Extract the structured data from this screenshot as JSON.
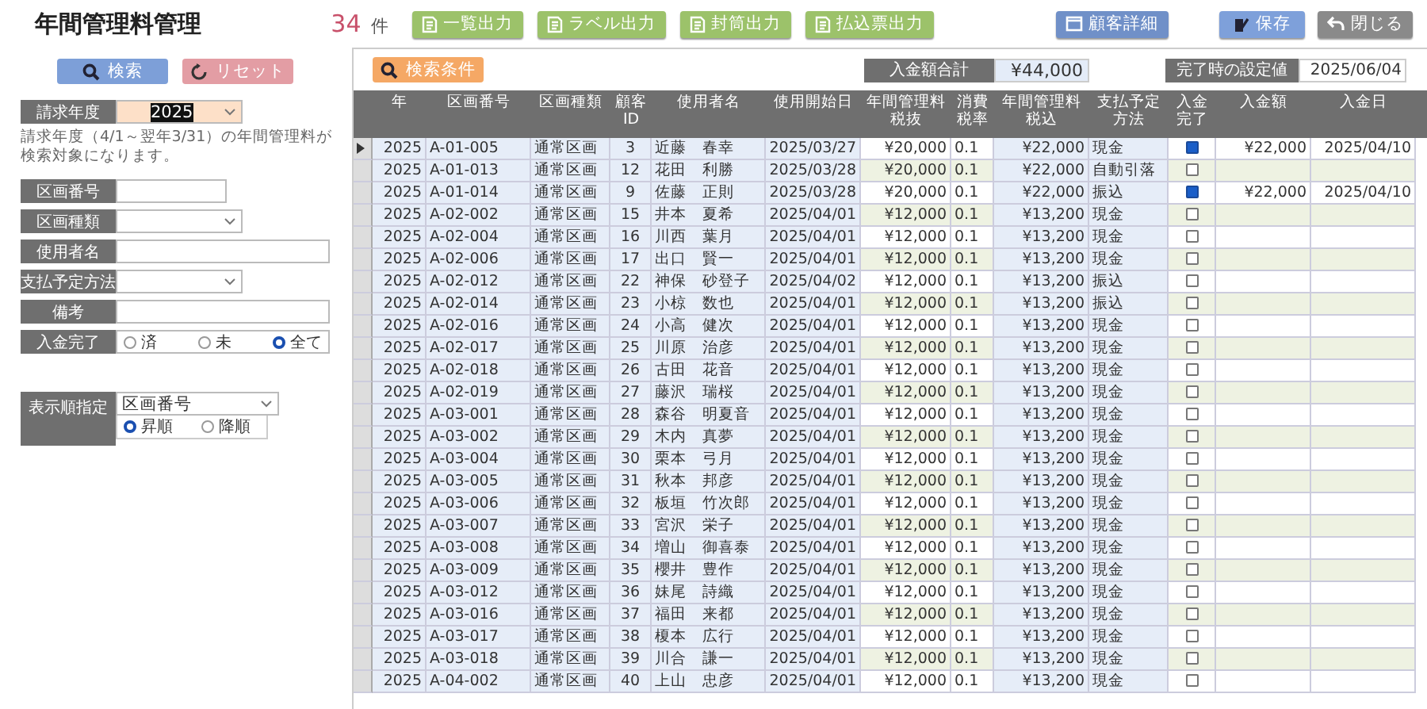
{
  "title": "年間管理料管理",
  "count": {
    "value": "34",
    "unit": "件"
  },
  "toolbar_buttons": [
    {
      "label": "一覧出力",
      "kind": "output"
    },
    {
      "label": "ラベル出力",
      "kind": "output"
    },
    {
      "label": "封筒出力",
      "kind": "output"
    },
    {
      "label": "払込票出力",
      "kind": "output"
    },
    {
      "label": "顧客詳細",
      "kind": "detail"
    },
    {
      "label": "保存",
      "kind": "save"
    },
    {
      "label": "閉じる",
      "kind": "close"
    }
  ],
  "search_panel": {
    "search_button": "検索",
    "reset_button": "リセット",
    "fields": [
      {
        "kind": "combo",
        "label": "請求年度",
        "value": "2025",
        "highlighted": true
      },
      {
        "kind": "note",
        "text": "請求年度（4/1～翌年3/31）の年間管理料が検索対象になります。"
      },
      {
        "kind": "text",
        "label": "区画番号"
      },
      {
        "kind": "combo",
        "label": "区画種類"
      },
      {
        "kind": "text_wide",
        "label": "使用者名"
      },
      {
        "kind": "combo",
        "label": "支払予定方法"
      },
      {
        "kind": "text_wide",
        "label": "備考"
      },
      {
        "kind": "radio",
        "label": "入金完了",
        "options": [
          {
            "label": "済",
            "selected": false
          },
          {
            "label": "未",
            "selected": false
          },
          {
            "label": "全て",
            "selected": true
          }
        ]
      }
    ],
    "sort": {
      "label": "表示順指定",
      "value": "区画番号",
      "options": [
        {
          "label": "昇順",
          "selected": true
        },
        {
          "label": "降順",
          "selected": false
        }
      ]
    }
  },
  "results": {
    "filter_button": "検索条件",
    "total": {
      "label": "入金額合計",
      "value": "¥44,000"
    },
    "completion": {
      "label": "完了時の設定値",
      "value": "2025/06/04"
    },
    "columns": [
      "年",
      "区画番号",
      "区画種類",
      "顧客ID",
      "使用者名",
      "使用開始日",
      "年間管理料税抜",
      "消費税率",
      "年間管理料税込",
      "支払予定方法",
      "入金完了",
      "入金額",
      "入金日"
    ],
    "rows": [
      {
        "current": true,
        "year": "2025",
        "lot": "A-01-005",
        "type": "通常区画",
        "id": "3",
        "name": "近藤　春幸",
        "start": "2025/03/27",
        "fee_ex": "¥20,000",
        "tax": "0.1",
        "fee_in": "¥22,000",
        "method": "現金",
        "paid": true,
        "amount": "¥22,000",
        "date": "2025/04/10"
      },
      {
        "current": false,
        "year": "2025",
        "lot": "A-01-013",
        "type": "通常区画",
        "id": "12",
        "name": "花田　利勝",
        "start": "2025/03/28",
        "fee_ex": "¥20,000",
        "tax": "0.1",
        "fee_in": "¥22,000",
        "method": "自動引落",
        "paid": false
      },
      {
        "current": false,
        "year": "2025",
        "lot": "A-01-014",
        "type": "通常区画",
        "id": "9",
        "name": "佐藤　正則",
        "start": "2025/03/28",
        "fee_ex": "¥20,000",
        "tax": "0.1",
        "fee_in": "¥22,000",
        "method": "振込",
        "paid": true,
        "amount": "¥22,000",
        "date": "2025/04/10"
      },
      {
        "current": false,
        "year": "2025",
        "lot": "A-02-002",
        "type": "通常区画",
        "id": "15",
        "name": "井本　夏希",
        "start": "2025/04/01",
        "fee_ex": "¥12,000",
        "tax": "0.1",
        "fee_in": "¥13,200",
        "method": "現金",
        "paid": false
      },
      {
        "current": false,
        "year": "2025",
        "lot": "A-02-004",
        "type": "通常区画",
        "id": "16",
        "name": "川西　葉月",
        "start": "2025/04/01",
        "fee_ex": "¥12,000",
        "tax": "0.1",
        "fee_in": "¥13,200",
        "method": "現金",
        "paid": false
      },
      {
        "current": false,
        "year": "2025",
        "lot": "A-02-006",
        "type": "通常区画",
        "id": "17",
        "name": "出口　賢一",
        "start": "2025/04/01",
        "fee_ex": "¥12,000",
        "tax": "0.1",
        "fee_in": "¥13,200",
        "method": "現金",
        "paid": false
      },
      {
        "current": false,
        "year": "2025",
        "lot": "A-02-012",
        "type": "通常区画",
        "id": "22",
        "name": "神保　砂登子",
        "start": "2025/04/02",
        "fee_ex": "¥12,000",
        "tax": "0.1",
        "fee_in": "¥13,200",
        "method": "振込",
        "paid": false
      },
      {
        "current": false,
        "year": "2025",
        "lot": "A-02-014",
        "type": "通常区画",
        "id": "23",
        "name": "小椋　数也",
        "start": "2025/04/01",
        "fee_ex": "¥12,000",
        "tax": "0.1",
        "fee_in": "¥13,200",
        "method": "振込",
        "paid": false
      },
      {
        "current": false,
        "year": "2025",
        "lot": "A-02-016",
        "type": "通常区画",
        "id": "24",
        "name": "小高　健次",
        "start": "2025/04/01",
        "fee_ex": "¥12,000",
        "tax": "0.1",
        "fee_in": "¥13,200",
        "method": "現金",
        "paid": false
      },
      {
        "current": false,
        "year": "2025",
        "lot": "A-02-017",
        "type": "通常区画",
        "id": "25",
        "name": "川原　治彦",
        "start": "2025/04/01",
        "fee_ex": "¥12,000",
        "tax": "0.1",
        "fee_in": "¥13,200",
        "method": "現金",
        "paid": false
      },
      {
        "current": false,
        "year": "2025",
        "lot": "A-02-018",
        "type": "通常区画",
        "id": "26",
        "name": "古田　花音",
        "start": "2025/04/01",
        "fee_ex": "¥12,000",
        "tax": "0.1",
        "fee_in": "¥13,200",
        "method": "現金",
        "paid": false
      },
      {
        "current": false,
        "year": "2025",
        "lot": "A-02-019",
        "type": "通常区画",
        "id": "27",
        "name": "藤沢　瑞桜",
        "start": "2025/04/01",
        "fee_ex": "¥12,000",
        "tax": "0.1",
        "fee_in": "¥13,200",
        "method": "現金",
        "paid": false
      },
      {
        "current": false,
        "year": "2025",
        "lot": "A-03-001",
        "type": "通常区画",
        "id": "28",
        "name": "森谷　明夏音",
        "start": "2025/04/01",
        "fee_ex": "¥12,000",
        "tax": "0.1",
        "fee_in": "¥13,200",
        "method": "現金",
        "paid": false
      },
      {
        "current": false,
        "year": "2025",
        "lot": "A-03-002",
        "type": "通常区画",
        "id": "29",
        "name": "木内　真夢",
        "start": "2025/04/01",
        "fee_ex": "¥12,000",
        "tax": "0.1",
        "fee_in": "¥13,200",
        "method": "現金",
        "paid": false
      },
      {
        "current": false,
        "year": "2025",
        "lot": "A-03-004",
        "type": "通常区画",
        "id": "30",
        "name": "栗本　弓月",
        "start": "2025/04/01",
        "fee_ex": "¥12,000",
        "tax": "0.1",
        "fee_in": "¥13,200",
        "method": "現金",
        "paid": false
      },
      {
        "current": false,
        "year": "2025",
        "lot": "A-03-005",
        "type": "通常区画",
        "id": "31",
        "name": "秋本　邦彦",
        "start": "2025/04/01",
        "fee_ex": "¥12,000",
        "tax": "0.1",
        "fee_in": "¥13,200",
        "method": "現金",
        "paid": false
      },
      {
        "current": false,
        "year": "2025",
        "lot": "A-03-006",
        "type": "通常区画",
        "id": "32",
        "name": "板垣　竹次郎",
        "start": "2025/04/01",
        "fee_ex": "¥12,000",
        "tax": "0.1",
        "fee_in": "¥13,200",
        "method": "現金",
        "paid": false
      },
      {
        "current": false,
        "year": "2025",
        "lot": "A-03-007",
        "type": "通常区画",
        "id": "33",
        "name": "宮沢　栄子",
        "start": "2025/04/01",
        "fee_ex": "¥12,000",
        "tax": "0.1",
        "fee_in": "¥13,200",
        "method": "現金",
        "paid": false
      },
      {
        "current": false,
        "year": "2025",
        "lot": "A-03-008",
        "type": "通常区画",
        "id": "34",
        "name": "増山　御喜泰",
        "start": "2025/04/01",
        "fee_ex": "¥12,000",
        "tax": "0.1",
        "fee_in": "¥13,200",
        "method": "現金",
        "paid": false
      },
      {
        "current": false,
        "year": "2025",
        "lot": "A-03-009",
        "type": "通常区画",
        "id": "35",
        "name": "櫻井　豊作",
        "start": "2025/04/01",
        "fee_ex": "¥12,000",
        "tax": "0.1",
        "fee_in": "¥13,200",
        "method": "現金",
        "paid": false
      },
      {
        "current": false,
        "year": "2025",
        "lot": "A-03-012",
        "type": "通常区画",
        "id": "36",
        "name": "妹尾　詩織",
        "start": "2025/04/01",
        "fee_ex": "¥12,000",
        "tax": "0.1",
        "fee_in": "¥13,200",
        "method": "現金",
        "paid": false
      },
      {
        "current": false,
        "year": "2025",
        "lot": "A-03-016",
        "type": "通常区画",
        "id": "37",
        "name": "福田　来都",
        "start": "2025/04/01",
        "fee_ex": "¥12,000",
        "tax": "0.1",
        "fee_in": "¥13,200",
        "method": "現金",
        "paid": false
      },
      {
        "current": false,
        "year": "2025",
        "lot": "A-03-017",
        "type": "通常区画",
        "id": "38",
        "name": "榎本　広行",
        "start": "2025/04/01",
        "fee_ex": "¥12,000",
        "tax": "0.1",
        "fee_in": "¥13,200",
        "method": "現金",
        "paid": false
      },
      {
        "current": false,
        "year": "2025",
        "lot": "A-03-018",
        "type": "通常区画",
        "id": "39",
        "name": "川合　謙一",
        "start": "2025/04/01",
        "fee_ex": "¥12,000",
        "tax": "0.1",
        "fee_in": "¥13,200",
        "method": "現金",
        "paid": false
      },
      {
        "current": false,
        "year": "2025",
        "lot": "A-04-002",
        "type": "通常区画",
        "id": "40",
        "name": "上山　忠彦",
        "start": "2025/04/01",
        "fee_ex": "¥12,000",
        "tax": "0.1",
        "fee_in": "¥13,200",
        "method": "現金",
        "paid": false
      }
    ]
  }
}
